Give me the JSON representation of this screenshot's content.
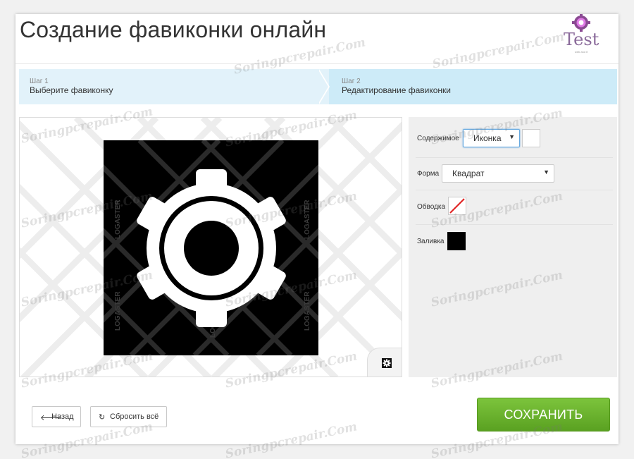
{
  "page": {
    "title": "Создание фавиконки онлайн"
  },
  "logo": {
    "text": "Test",
    "sub": "web and it"
  },
  "steps": [
    {
      "label": "Шаг 1",
      "name": "Выберите фавиконку"
    },
    {
      "label": "Шаг 2",
      "name": "Редактирование фавиконки"
    }
  ],
  "editor": {
    "watermark_text": "LOGASTER",
    "icon": "gear-icon",
    "background_color": "#000000",
    "icon_color": "#ffffff"
  },
  "settings": {
    "content": {
      "label": "Содержимое",
      "value": "Иконка"
    },
    "shape": {
      "label": "Форма",
      "value": "Квадрат"
    },
    "stroke": {
      "label": "Обводка",
      "value": "none"
    },
    "fill": {
      "label": "Заливка",
      "color": "#000000"
    }
  },
  "buttons": {
    "back": "Назад",
    "reset": "Сбросить всё",
    "save": "СОХРАНИТЬ"
  },
  "watermark": "Soringpcrepair.Com",
  "colors": {
    "accent_green": "#6cb52f",
    "step_blue": "#d9eff9",
    "logo_purple": "#c06cc8"
  }
}
